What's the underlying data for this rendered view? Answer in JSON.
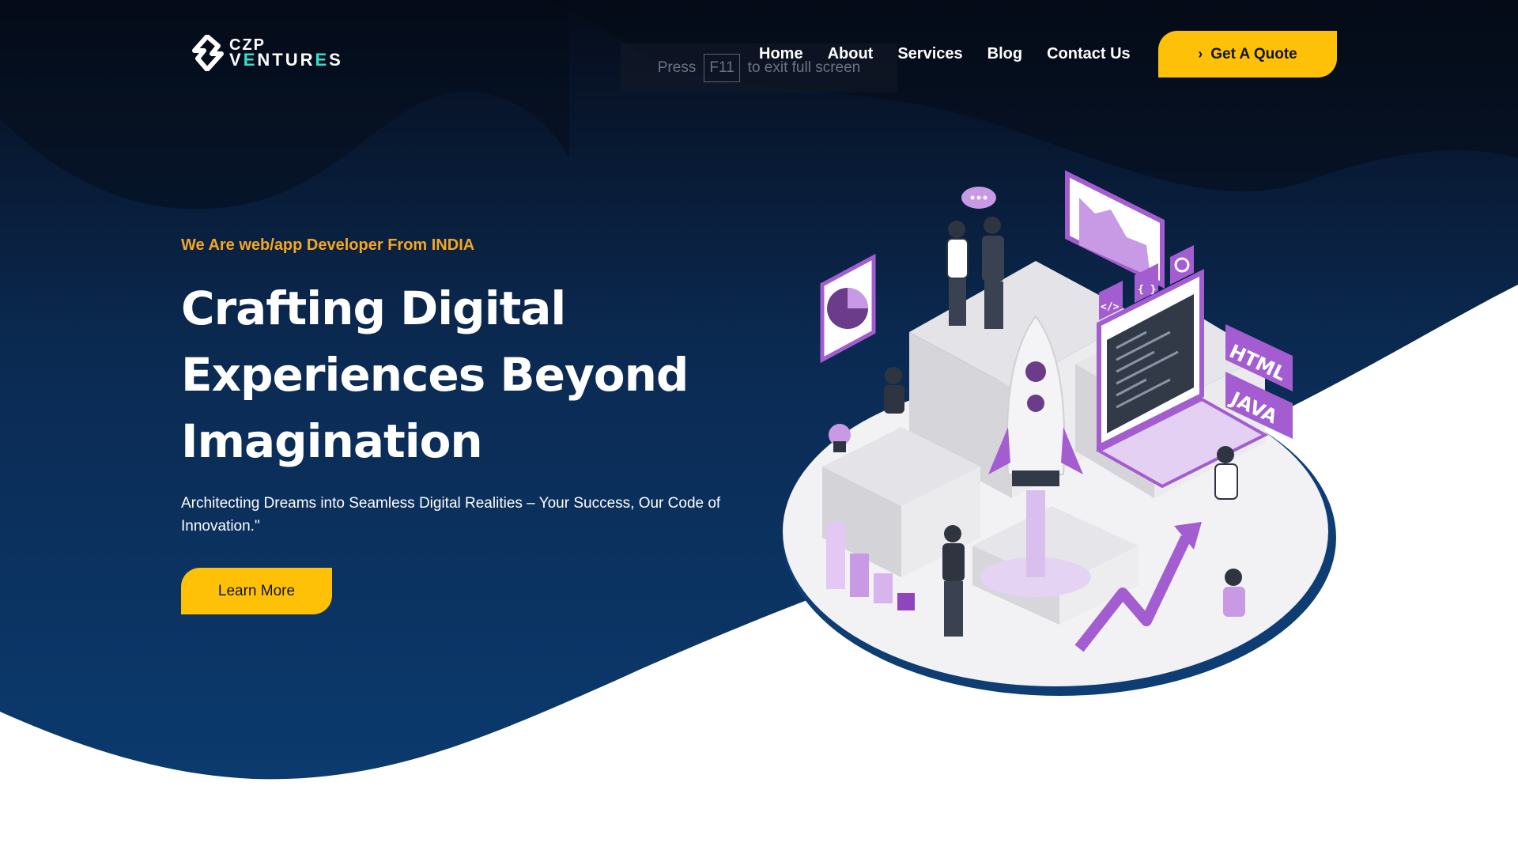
{
  "brand": {
    "line1": "CZP",
    "line2_a": "V",
    "line2_b": "E",
    "line2_c": "NTUR",
    "line2_d": "E",
    "line2_e": "S"
  },
  "fullscreen_notice": {
    "press": "Press",
    "key": "F11",
    "rest": "to exit full screen"
  },
  "nav": {
    "items": [
      {
        "label": "Home"
      },
      {
        "label": "About"
      },
      {
        "label": "Services"
      },
      {
        "label": "Blog"
      },
      {
        "label": "Contact Us"
      }
    ],
    "cta_icon": "chevron-right-icon",
    "cta_label": "Get A Quote"
  },
  "hero": {
    "eyebrow": "We Are web/app Developer From INDIA",
    "headline_lines": [
      "Crafting Digital",
      "Experiences Beyond",
      "Imagination"
    ],
    "subtext": "Architecting Dreams into Seamless Digital Realities – Your Success, Our Code of Innovation.\"",
    "button_label": "Learn More"
  },
  "illustration": {
    "badges": [
      "HTML",
      "JAVA"
    ],
    "code_tags": [
      "</>",
      "{ }"
    ]
  },
  "colors": {
    "hero_dark": "#0a1122",
    "hero_blue": "#0b3a6e",
    "accent_yellow": "#ffc107",
    "eyebrow_orange": "#f5a623",
    "illustration_purple": "#a35dd0"
  }
}
